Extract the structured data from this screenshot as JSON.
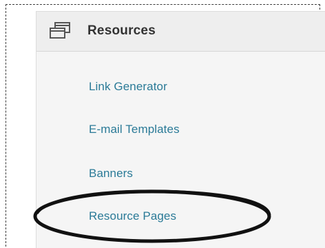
{
  "section": {
    "title": "Resources",
    "icon": "window-stack-icon"
  },
  "nav": {
    "items": [
      {
        "label": "Link Generator"
      },
      {
        "label": "E-mail Templates"
      },
      {
        "label": "Banners"
      },
      {
        "label": "Resource Pages"
      }
    ]
  },
  "colors": {
    "link": "#2a7a97",
    "header_bg": "#eeeeee",
    "panel_bg": "#f5f5f5"
  }
}
